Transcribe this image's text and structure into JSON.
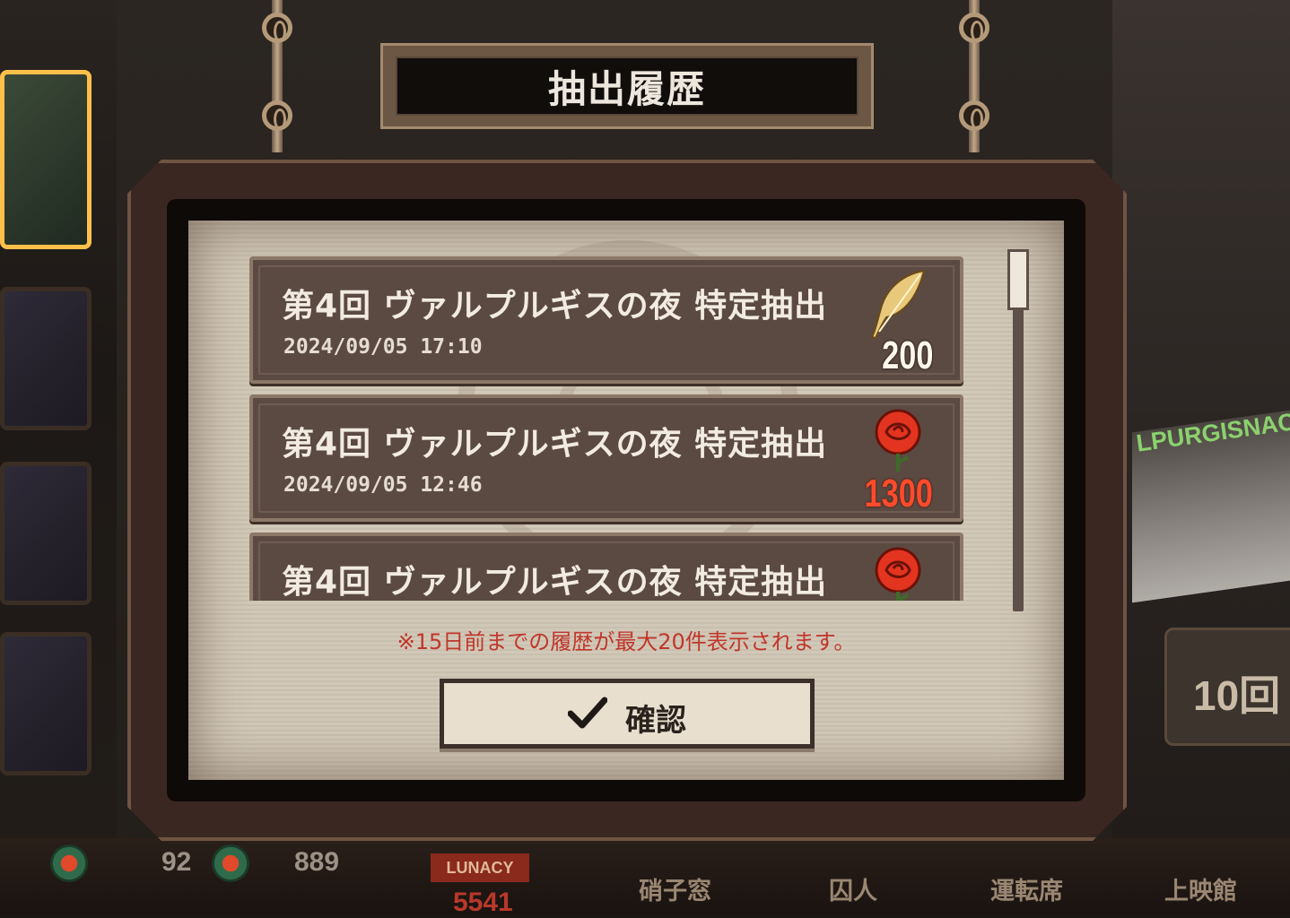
{
  "dialog": {
    "title": "抽出履歴",
    "entries": [
      {
        "title": "第4回 ヴァルプルギスの夜 特定抽出",
        "date": "2024/09/05 17:10",
        "cost_icon": "feather-icon",
        "cost": "200"
      },
      {
        "title": "第4回 ヴァルプルギスの夜 特定抽出",
        "date": "2024/09/05 12:46",
        "cost_icon": "rose-icon",
        "cost": "1300"
      },
      {
        "title": "第4回 ヴァルプルギスの夜 特定抽出",
        "date": "",
        "cost_icon": "rose-icon",
        "cost": ""
      }
    ],
    "notice": "※15日前までの履歴が最大20件表示されます。",
    "confirm_label": "確認"
  },
  "background": {
    "banner_text": "LPURGISNACH",
    "ten_pull_label": "10回",
    "stats": {
      "left": "92",
      "right": "889"
    },
    "lunacy_label": "LUNACY",
    "lunacy_value": "5541",
    "nav": [
      "硝子窓",
      "囚人",
      "運転席",
      "上映館"
    ]
  },
  "colors": {
    "notice": "#c0362a",
    "rose_cost": "#ff4b2b",
    "entry_bg": "#5b4a42",
    "title_plate": "#100d0b"
  }
}
